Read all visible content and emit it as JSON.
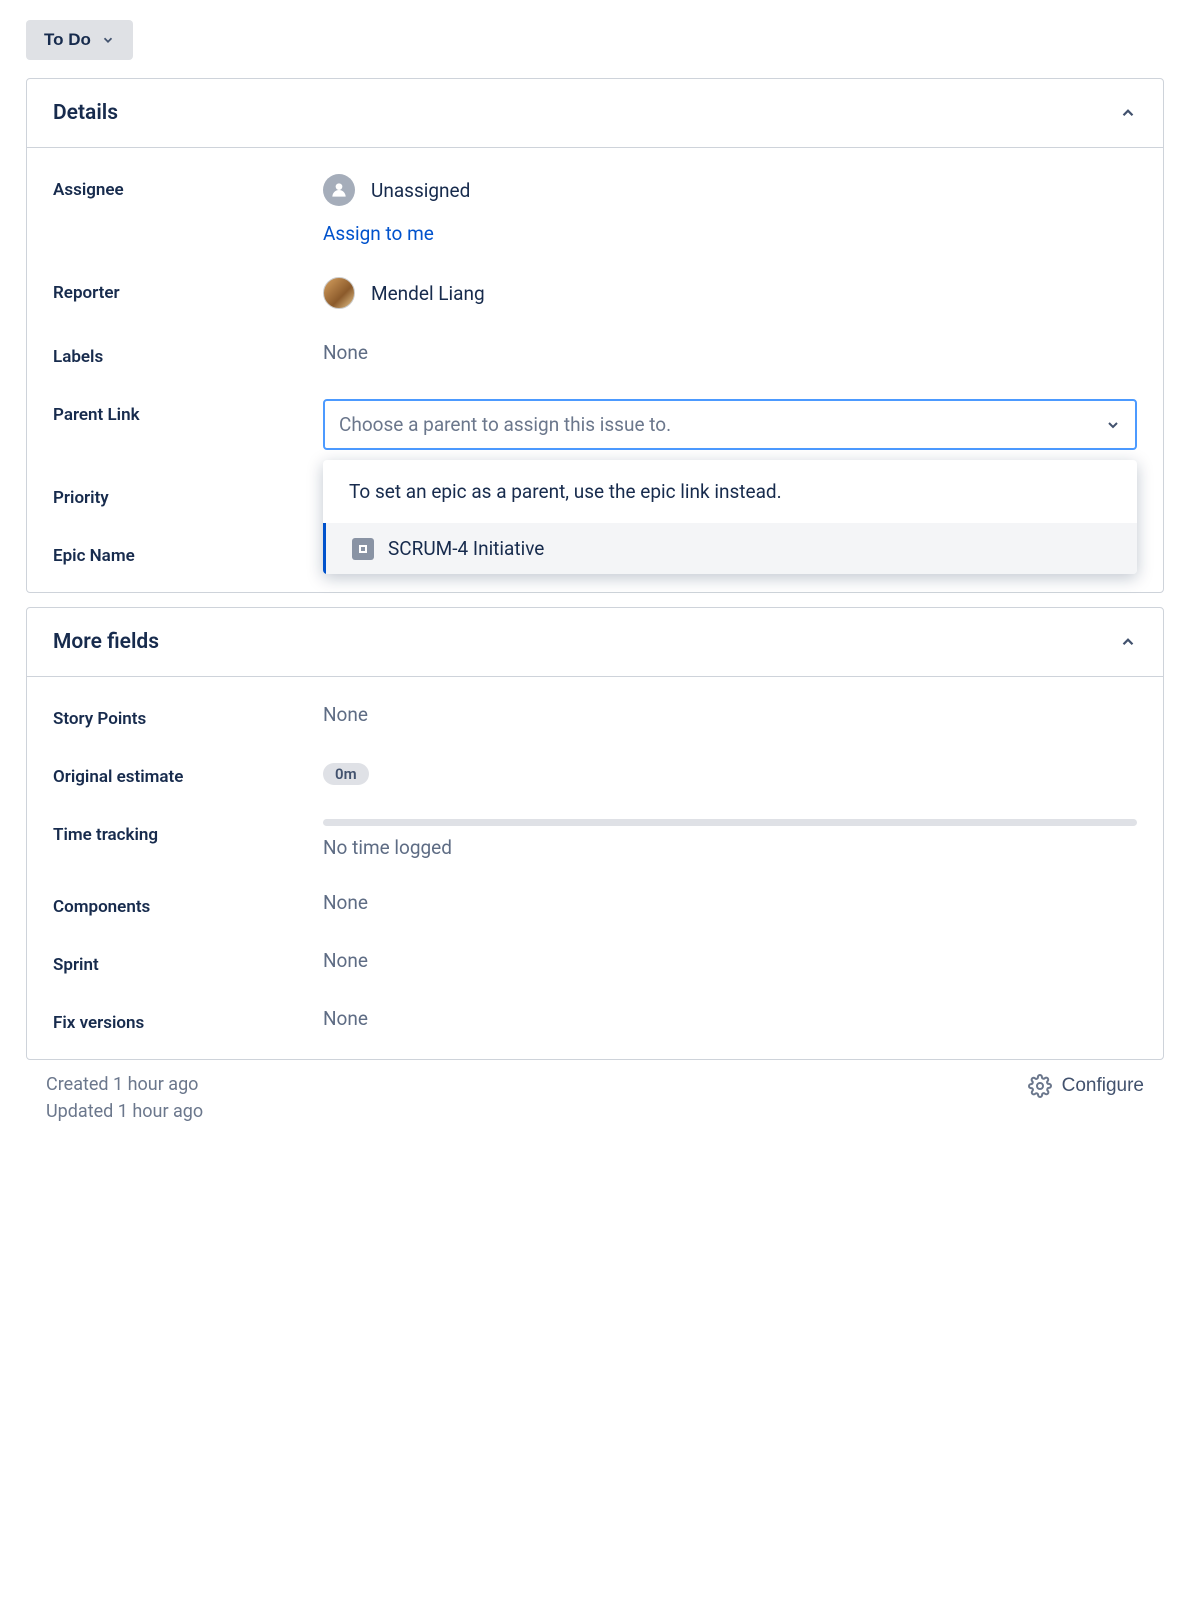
{
  "status": {
    "label": "To Do"
  },
  "panels": {
    "details": {
      "title": "Details"
    },
    "moreFields": {
      "title": "More fields"
    }
  },
  "details": {
    "assignee": {
      "label": "Assignee",
      "value": "Unassigned",
      "assignToMe": "Assign to me"
    },
    "reporter": {
      "label": "Reporter",
      "value": "Mendel Liang"
    },
    "labels": {
      "label": "Labels",
      "value": "None"
    },
    "parentLink": {
      "label": "Parent Link",
      "placeholder": "Choose a parent to assign this issue to.",
      "hint": "To set an epic as a parent, use the epic link instead.",
      "option": "SCRUM-4 Initiative"
    },
    "priority": {
      "label": "Priority"
    },
    "epicName": {
      "label": "Epic Name"
    }
  },
  "moreFields": {
    "storyPoints": {
      "label": "Story Points",
      "value": "None"
    },
    "originalEstimate": {
      "label": "Original estimate",
      "value": "0m"
    },
    "timeTracking": {
      "label": "Time tracking",
      "value": "No time logged"
    },
    "components": {
      "label": "Components",
      "value": "None"
    },
    "sprint": {
      "label": "Sprint",
      "value": "None"
    },
    "fixVersions": {
      "label": "Fix versions",
      "value": "None"
    }
  },
  "footer": {
    "created": "Created 1 hour ago",
    "updated": "Updated 1 hour ago",
    "configure": "Configure"
  }
}
